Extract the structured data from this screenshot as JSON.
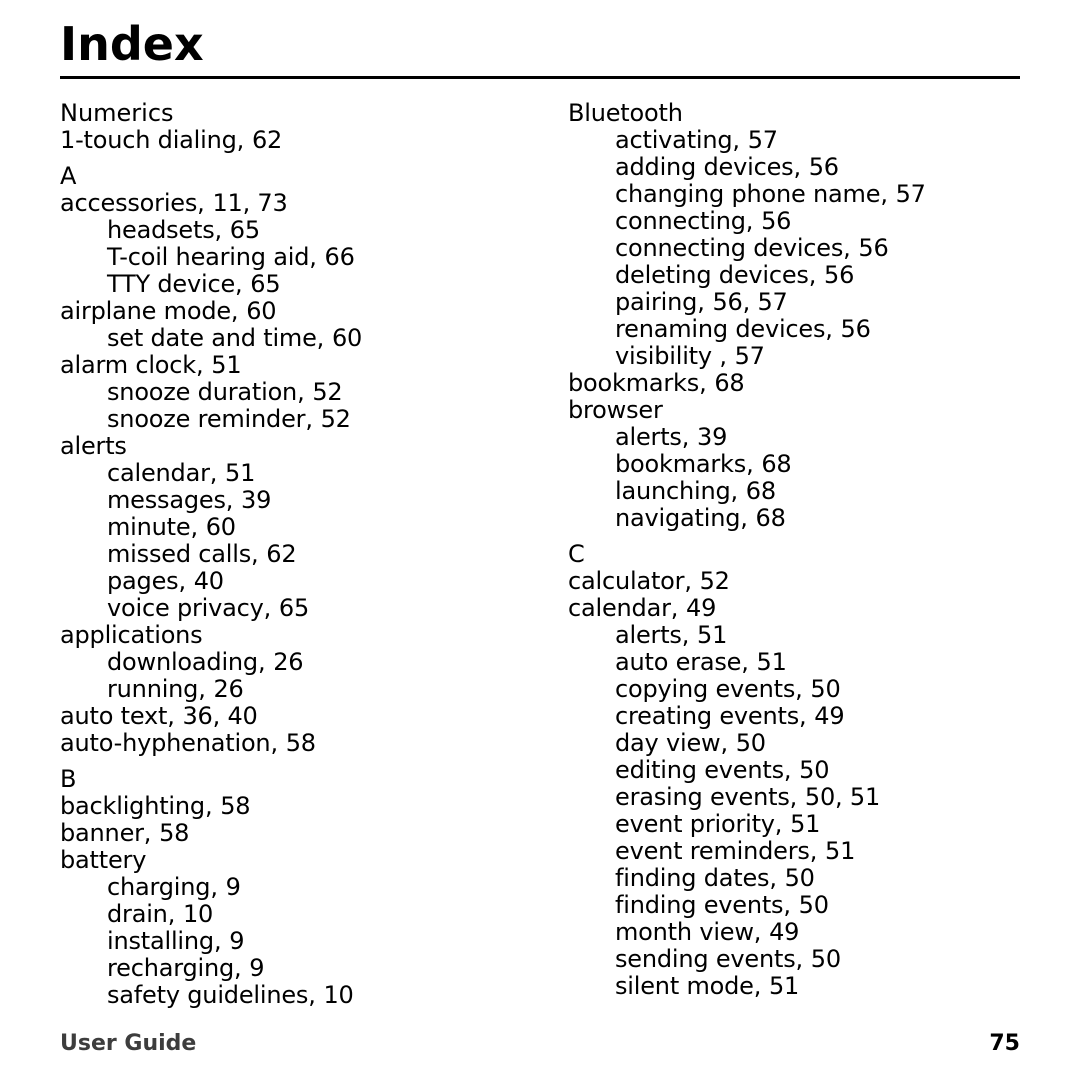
{
  "document": {
    "title": "Index",
    "footer_left": "User Guide",
    "footer_right": "75"
  },
  "columns": [
    {
      "id": "left",
      "blocks": [
        {
          "heading": "Numerics",
          "heading_is_letter": false,
          "entries": [
            {
              "level": 0,
              "term": "1-touch dialing",
              "pages": "62"
            }
          ]
        },
        {
          "heading": "A",
          "heading_is_letter": true,
          "entries": [
            {
              "level": 0,
              "term": "accessories",
              "pages": "11, 73"
            },
            {
              "level": 1,
              "term": "headsets",
              "pages": "65"
            },
            {
              "level": 1,
              "term": "T-coil hearing aid",
              "pages": "66"
            },
            {
              "level": 1,
              "term": "TTY device",
              "pages": "65"
            },
            {
              "level": 0,
              "term": "airplane mode",
              "pages": "60"
            },
            {
              "level": 1,
              "term": "set date and time",
              "pages": "60"
            },
            {
              "level": 0,
              "term": "alarm clock",
              "pages": "51"
            },
            {
              "level": 1,
              "term": "snooze duration",
              "pages": "52"
            },
            {
              "level": 1,
              "term": "snooze reminder",
              "pages": "52"
            },
            {
              "level": 0,
              "term": "alerts",
              "pages": ""
            },
            {
              "level": 1,
              "term": "calendar",
              "pages": "51"
            },
            {
              "level": 1,
              "term": "messages",
              "pages": "39"
            },
            {
              "level": 1,
              "term": "minute",
              "pages": "60"
            },
            {
              "level": 1,
              "term": "missed calls",
              "pages": "62"
            },
            {
              "level": 1,
              "term": "pages",
              "pages": "40"
            },
            {
              "level": 1,
              "term": "voice privacy",
              "pages": "65"
            },
            {
              "level": 0,
              "term": "applications",
              "pages": ""
            },
            {
              "level": 1,
              "term": "downloading",
              "pages": "26"
            },
            {
              "level": 1,
              "term": "running",
              "pages": "26"
            },
            {
              "level": 0,
              "term": "auto text",
              "pages": "36, 40"
            },
            {
              "level": 0,
              "term": "auto-hyphenation",
              "pages": "58"
            }
          ]
        },
        {
          "heading": "B",
          "heading_is_letter": true,
          "entries": [
            {
              "level": 0,
              "term": "backlighting",
              "pages": "58"
            },
            {
              "level": 0,
              "term": "banner",
              "pages": "58"
            },
            {
              "level": 0,
              "term": "battery",
              "pages": ""
            },
            {
              "level": 1,
              "term": "charging",
              "pages": "9"
            },
            {
              "level": 1,
              "term": "drain",
              "pages": "10"
            },
            {
              "level": 1,
              "term": "installing",
              "pages": "9"
            },
            {
              "level": 1,
              "term": "recharging",
              "pages": "9"
            },
            {
              "level": 1,
              "term": "safety guidelines",
              "pages": "10"
            }
          ]
        }
      ]
    },
    {
      "id": "right",
      "blocks": [
        {
          "heading": "",
          "heading_is_letter": false,
          "entries": [
            {
              "level": 0,
              "term": "Bluetooth",
              "pages": ""
            },
            {
              "level": 1,
              "term": "activating",
              "pages": "57"
            },
            {
              "level": 1,
              "term": "adding devices",
              "pages": "56"
            },
            {
              "level": 1,
              "term": "changing phone name",
              "pages": "57"
            },
            {
              "level": 1,
              "term": "connecting",
              "pages": "56"
            },
            {
              "level": 1,
              "term": "connecting devices",
              "pages": "56"
            },
            {
              "level": 1,
              "term": "deleting devices",
              "pages": "56"
            },
            {
              "level": 1,
              "term": "pairing",
              "pages": "56, 57"
            },
            {
              "level": 1,
              "term": "renaming devices",
              "pages": "56"
            },
            {
              "level": 1,
              "term": "visibility ",
              "pages": "57"
            },
            {
              "level": 0,
              "term": "bookmarks",
              "pages": "68"
            },
            {
              "level": 0,
              "term": "browser",
              "pages": ""
            },
            {
              "level": 1,
              "term": "alerts",
              "pages": "39"
            },
            {
              "level": 1,
              "term": "bookmarks",
              "pages": "68"
            },
            {
              "level": 1,
              "term": "launching",
              "pages": "68"
            },
            {
              "level": 1,
              "term": "navigating",
              "pages": "68"
            }
          ]
        },
        {
          "heading": "C",
          "heading_is_letter": true,
          "entries": [
            {
              "level": 0,
              "term": "calculator",
              "pages": "52"
            },
            {
              "level": 0,
              "term": "calendar",
              "pages": "49"
            },
            {
              "level": 1,
              "term": "alerts",
              "pages": "51"
            },
            {
              "level": 1,
              "term": "auto erase",
              "pages": "51"
            },
            {
              "level": 1,
              "term": "copying events",
              "pages": "50"
            },
            {
              "level": 1,
              "term": "creating events",
              "pages": "49"
            },
            {
              "level": 1,
              "term": "day view",
              "pages": "50"
            },
            {
              "level": 1,
              "term": "editing events",
              "pages": "50"
            },
            {
              "level": 1,
              "term": "erasing events",
              "pages": "50, 51"
            },
            {
              "level": 1,
              "term": "event priority",
              "pages": "51"
            },
            {
              "level": 1,
              "term": "event reminders",
              "pages": "51"
            },
            {
              "level": 1,
              "term": "finding dates",
              "pages": "50"
            },
            {
              "level": 1,
              "term": "finding events",
              "pages": "50"
            },
            {
              "level": 1,
              "term": "month view",
              "pages": "49"
            },
            {
              "level": 1,
              "term": "sending events",
              "pages": "50"
            },
            {
              "level": 1,
              "term": "silent mode",
              "pages": "51"
            }
          ]
        }
      ]
    }
  ]
}
